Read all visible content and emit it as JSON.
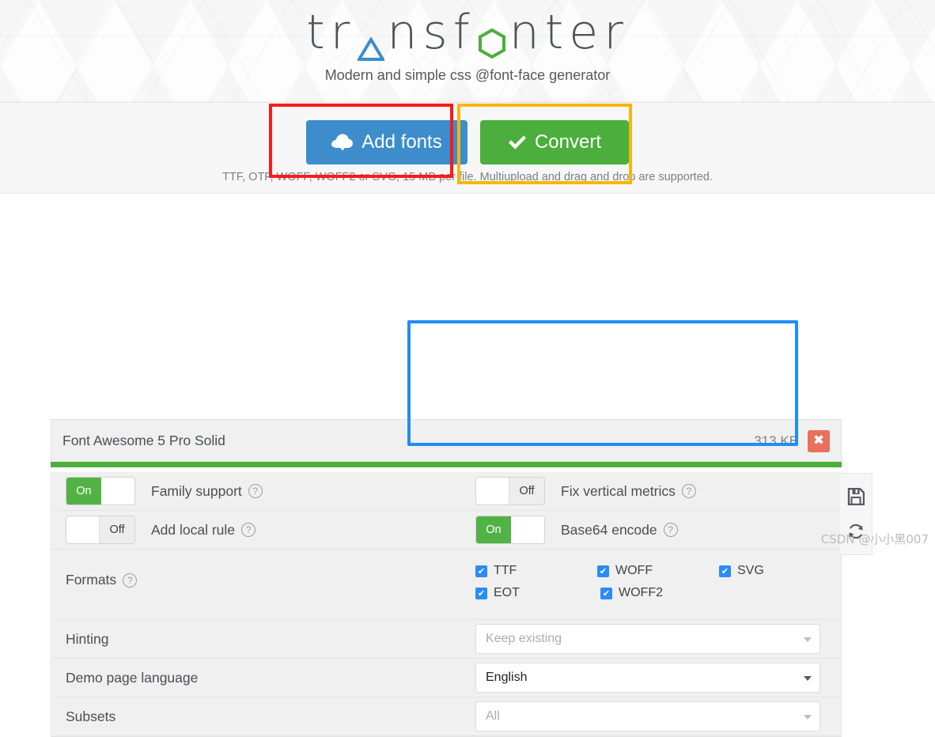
{
  "header": {
    "logo_text_parts": [
      "tr",
      "nsf",
      "nter"
    ],
    "logo_full": "transfonter",
    "tagline": "Modern and simple css @font-face generator"
  },
  "actions": {
    "add_fonts_label": "Add fonts",
    "convert_label": "Convert",
    "hint": "TTF, OTF, WOFF, WOFF2 or SVG, 15 MB per file. Multiupload and drag and drop are supported.",
    "add_fonts_color": "#3d8dcc",
    "convert_color": "#4cae3c"
  },
  "annotations": {
    "red_color": "#f91b1b",
    "orange_color": "#f8b60d",
    "blue_color": "#1e8ef5"
  },
  "font_file": {
    "name": "Font Awesome 5 Pro Solid",
    "size": "313 KB",
    "delete_glyph": "✖",
    "progress_color": "#4cae3c",
    "progress_percent": 100
  },
  "options": {
    "toggles": [
      {
        "state": "On",
        "label": "Family support"
      },
      {
        "state": "Off",
        "label": "Fix vertical metrics"
      },
      {
        "state": "Off",
        "label": "Add local rule"
      },
      {
        "state": "On",
        "label": "Base64 encode"
      }
    ],
    "formats_label": "Formats",
    "formats": [
      {
        "label": "TTF",
        "checked": true
      },
      {
        "label": "WOFF",
        "checked": true
      },
      {
        "label": "SVG",
        "checked": true
      },
      {
        "label": "EOT",
        "checked": true
      },
      {
        "label": "WOFF2",
        "checked": true
      }
    ],
    "selects": [
      {
        "label": "Hinting",
        "value": "Keep existing",
        "placeholder": true
      },
      {
        "label": "Demo page language",
        "value": "English",
        "placeholder": false
      },
      {
        "label": "Subsets",
        "value": "All",
        "placeholder": true
      }
    ],
    "help_glyph": "?"
  },
  "rail": {
    "save_title": "Save settings",
    "reset_title": "Reset settings"
  },
  "watermark": "CSDN @小小黑007"
}
